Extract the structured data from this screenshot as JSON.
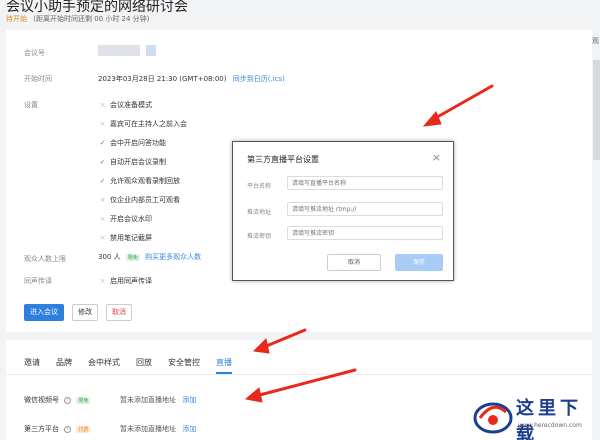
{
  "header": {
    "title": "会议小助手预定的网络研讨会",
    "status": "待开始",
    "remaining": "(距离开始时间还剩 00 小时 24 分钟)"
  },
  "info": {
    "meeting_id_label": "会议号",
    "start_time_label": "开始时间",
    "start_time_value": "2023年03月28日 21:30 (GMT+08:00)",
    "sync_calendar_link": "同步到日历(.ics)",
    "settings_label": "设置",
    "settings": [
      {
        "label": "会议准备模式",
        "enabled": false
      },
      {
        "label": "嘉宾可在主持人之前入会",
        "enabled": false
      },
      {
        "label": "会中开启问答功能",
        "enabled": true
      },
      {
        "label": "自动开启会议录制",
        "enabled": true
      },
      {
        "label": "允许观众观看录制回放",
        "enabled": true
      },
      {
        "label": "仅企业内部员工可观看",
        "enabled": false
      },
      {
        "label": "开启会议水印",
        "enabled": false
      },
      {
        "label": "禁用笔记截屏",
        "enabled": false
      }
    ],
    "audience_limit_label": "观众人数上限",
    "audience_limit_value": "300 人",
    "audience_badge": "限免",
    "buy_more_link": "购买更多观众人数",
    "interpretation_label": "同声传译",
    "interpretation_value": "启用同声传译"
  },
  "actions": {
    "join": "进入会议",
    "edit": "修改",
    "cancel": "取消"
  },
  "tabs": [
    {
      "label": "邀请",
      "active": false
    },
    {
      "label": "品牌",
      "active": false
    },
    {
      "label": "会中样式",
      "active": false
    },
    {
      "label": "回放",
      "active": false
    },
    {
      "label": "安全管控",
      "active": false
    },
    {
      "label": "直播",
      "active": true
    }
  ],
  "live": {
    "rows": [
      {
        "label": "微信视频号",
        "badge": "限免",
        "note": "暂未添加直播地址",
        "link": "添加"
      },
      {
        "label": "第三方平台",
        "badge": "付费",
        "note": "暂未添加直播地址",
        "link": "添加"
      }
    ]
  },
  "modal": {
    "title": "第三方直播平台设置",
    "fields": [
      {
        "label": "平台名称",
        "placeholder": "请填写直播平台名称"
      },
      {
        "label": "推流地址",
        "placeholder": "请填写推流地址 rtmp://"
      },
      {
        "label": "推流密钥",
        "placeholder": "请填写推流密钥"
      }
    ],
    "cancel": "取消",
    "ok": "保存"
  },
  "side": {
    "label": "观"
  },
  "watermark": {
    "brand": "这里下载",
    "site": "www.herecdown.com"
  },
  "colors": {
    "accent": "#2e7fe0",
    "success": "#2fa84f",
    "warning": "#e08a1e",
    "arrow": "#e8291c"
  }
}
